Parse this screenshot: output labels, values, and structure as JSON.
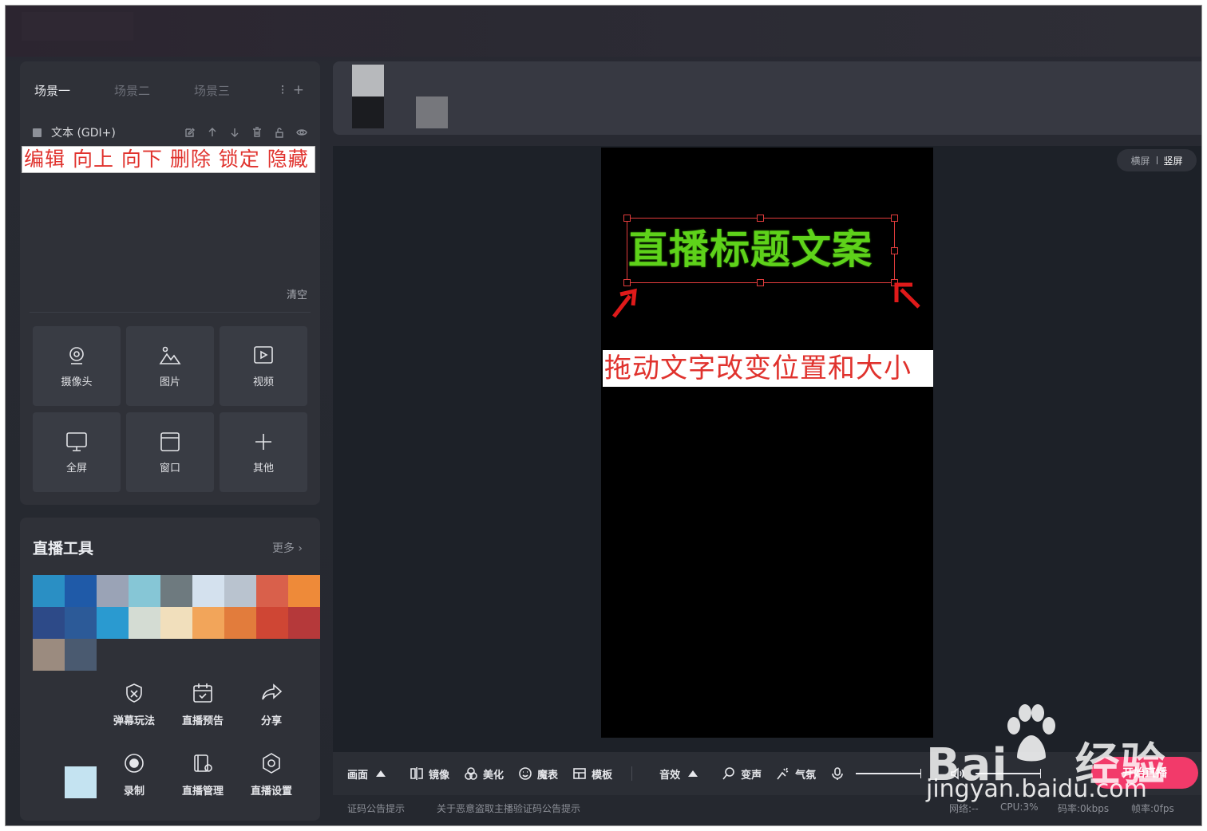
{
  "scenes": {
    "tabs": [
      {
        "label": "场景一",
        "active": true
      },
      {
        "label": "场景二",
        "active": false
      },
      {
        "label": "场景三",
        "active": false
      }
    ],
    "source_name": "文本 (GDI+)",
    "annotation": "编辑 向上 向下 删除 锁定 隐藏",
    "clear_label": "清空",
    "add_sources": [
      {
        "label": "摄像头",
        "icon": "camera-icon"
      },
      {
        "label": "图片",
        "icon": "image-icon"
      },
      {
        "label": "视频",
        "icon": "video-icon"
      },
      {
        "label": "全屏",
        "icon": "monitor-icon"
      },
      {
        "label": "窗口",
        "icon": "window-icon"
      },
      {
        "label": "其他",
        "icon": "plus-icon"
      }
    ]
  },
  "tools": {
    "title": "直播工具",
    "more_label": "更多",
    "items": [
      {
        "label": "弹幕玩法",
        "icon": "shield-icon"
      },
      {
        "label": "直播预告",
        "icon": "calendar-icon"
      },
      {
        "label": "分享",
        "icon": "share-icon"
      },
      {
        "label": "录制",
        "icon": "record-icon"
      },
      {
        "label": "直播管理",
        "icon": "manage-icon"
      },
      {
        "label": "直播设置",
        "icon": "settings-icon"
      }
    ]
  },
  "preview": {
    "orientation": {
      "landscape": "横屏",
      "portrait": "竖屏",
      "selected": "竖屏"
    },
    "stream_title_text": "直播标题文案",
    "drag_hint": "拖动文字改变位置和大小"
  },
  "toolbar": {
    "picture": "画面",
    "mirror": "镜像",
    "beauty": "美化",
    "emoji": "魔表",
    "template": "模板",
    "audio": "音效",
    "voice_change": "变声",
    "atmosphere": "气氛",
    "start_live": "开始直播"
  },
  "status": {
    "notice1": "证码公告提示",
    "notice2": "关于恶意盗取主播验证码公告提示",
    "network": "网络:--",
    "cpu": "CPU:3%",
    "bitrate": "码率:0kbps",
    "fps": "帧率:0fps"
  },
  "watermark": {
    "brand_left": "Bai",
    "brand_right": "经验",
    "url": "jingyan.baidu.com"
  },
  "colors": {
    "accent_start": "#f23a6a",
    "annotation_red": "#e0322d",
    "title_green": "#5ed21a",
    "selection_red": "#e23c3c"
  }
}
